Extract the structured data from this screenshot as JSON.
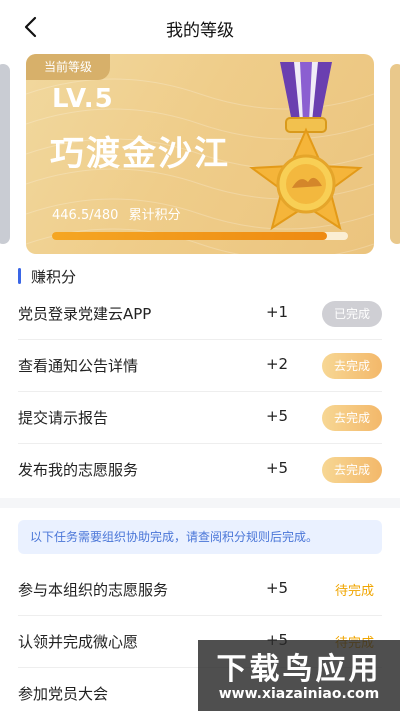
{
  "header": {
    "title": "我的等级",
    "back_icon": "chevron-left-icon"
  },
  "level_card": {
    "tag": "当前等级",
    "level": "LV.5",
    "rank_name": "巧渡金沙江",
    "score_value": "446.5/480",
    "score_label": "累计积分",
    "progress": 0.93,
    "colors": {
      "card": "#efcd8a",
      "progress": "#f5a623",
      "medal_ribbon": "#6a3fb0"
    }
  },
  "earn_section": {
    "title": "赚积分",
    "tasks": [
      {
        "name": "党员登录党建云APP",
        "points": "+1",
        "action": "已完成",
        "state": "done"
      },
      {
        "name": "查看通知公告详情",
        "points": "+2",
        "action": "去完成",
        "state": "todo"
      },
      {
        "name": "提交请示报告",
        "points": "+5",
        "action": "去完成",
        "state": "todo"
      },
      {
        "name": "发布我的志愿服务",
        "points": "+5",
        "action": "去完成",
        "state": "todo"
      }
    ]
  },
  "org_section": {
    "notice": "以下任务需要组织协助完成，请查阅积分规则后完成。",
    "tasks": [
      {
        "name": "参与本组织的志愿服务",
        "points": "+5",
        "status": "待完成"
      },
      {
        "name": "认领并完成微心愿",
        "points": "+5",
        "status": "待完成"
      },
      {
        "name": "参加党员大会",
        "points": "",
        "status": ""
      }
    ]
  },
  "watermark": {
    "title": "下载鸟应用",
    "url": "www.xiazainiao.com"
  }
}
